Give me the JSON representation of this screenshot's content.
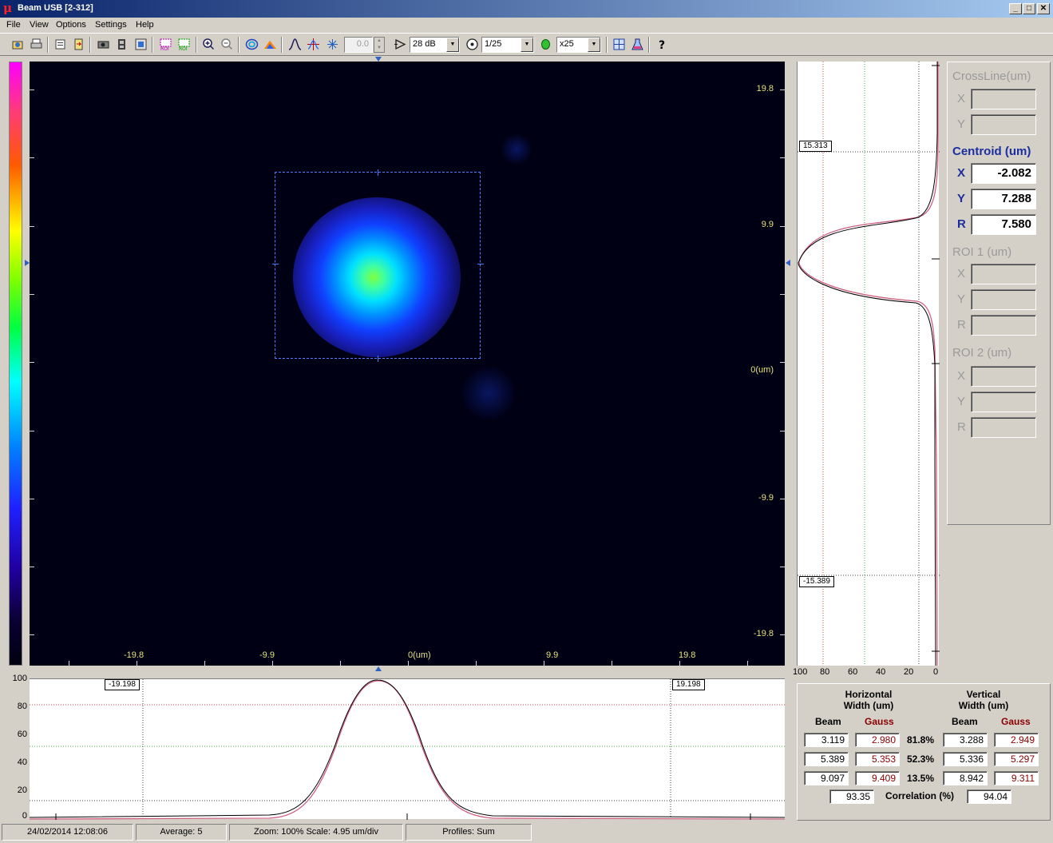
{
  "window": {
    "logo_glyph": "μ",
    "title": "Beam USB  [2-312]",
    "controls": [
      "_",
      "□",
      "✕"
    ]
  },
  "menu": [
    "File",
    "View",
    "Options",
    "Settings",
    "Help"
  ],
  "toolbar": {
    "value_field": "0.0",
    "gain": "28 dB",
    "exposure": "1/25",
    "averaging": "x25",
    "icons": [
      "open-icon",
      "print-icon",
      "properties-icon",
      "export-icon",
      "camera-icon",
      "film-icon",
      "snapshot-icon",
      "roi1-icon",
      "roi2-icon",
      "zoom-in-icon",
      "zoom-out-icon",
      "contour-icon",
      "3d-view-icon",
      "profile-icon",
      "crosshair-icon",
      "centroid-icon",
      "gain-icon",
      "exposure-icon",
      "average-icon",
      "calibrate-icon",
      "palette-icon",
      "help-icon"
    ]
  },
  "image": {
    "y_labels": [
      "19.8",
      "9.9",
      "0(um)",
      "-9.9",
      "-19.8"
    ],
    "x_labels": [
      "-19.8",
      "-9.9",
      "0(um)",
      "9.9",
      "19.8"
    ]
  },
  "vprofile": {
    "cursor_top": "15.313",
    "cursor_bottom": "-15.389",
    "axis_labels": [
      "100",
      "80",
      "60",
      "40",
      "20",
      "0"
    ]
  },
  "hprofile": {
    "cursor_left": "-19.198",
    "cursor_right": "19.198",
    "axis_labels": [
      "100",
      "80",
      "60",
      "40",
      "20",
      "0"
    ]
  },
  "crossline": {
    "title": "CrossLine(um)",
    "x_label": "X",
    "y_label": "Y",
    "x_value": "",
    "y_value": ""
  },
  "centroid": {
    "title": "Centroid (um)",
    "x_label": "X",
    "y_label": "Y",
    "r_label": "R",
    "x_value": "-2.082",
    "y_value": "7.288",
    "r_value": "7.580"
  },
  "roi1": {
    "title": "ROI 1 (um)",
    "x_label": "X",
    "y_label": "Y",
    "r_label": "R",
    "x_value": "",
    "y_value": "",
    "r_value": ""
  },
  "roi2": {
    "title": "ROI 2 (um)",
    "x_label": "X",
    "y_label": "Y",
    "r_label": "R",
    "x_value": "",
    "y_value": "",
    "r_value": ""
  },
  "widths": {
    "horizontal_title": "Horizontal\nWidth  (um)",
    "vertical_title": "Vertical\nWidth  (um)",
    "beam_label": "Beam",
    "gauss_label": "Gauss",
    "rows": [
      {
        "h_beam": "3.119",
        "h_gauss": "2.980",
        "pct": "81.8%",
        "v_beam": "3.288",
        "v_gauss": "2.949"
      },
      {
        "h_beam": "5.389",
        "h_gauss": "5.353",
        "pct": "52.3%",
        "v_beam": "5.336",
        "v_gauss": "5.297"
      },
      {
        "h_beam": "9.097",
        "h_gauss": "9.409",
        "pct": "13.5%",
        "v_beam": "8.942",
        "v_gauss": "9.311"
      }
    ],
    "correlation_label": "Correlation (%)",
    "h_correlation": "93.35",
    "v_correlation": "94.04"
  },
  "status": {
    "datetime": "24/02/2014 12:08:06",
    "average": "Average: 5",
    "zoom": "Zoom: 100%  Scale: 4.95 um/div",
    "profiles": "Profiles: Sum"
  },
  "colors": {
    "title_gradient_start": "#0a246a",
    "title_gradient_end": "#a6caf0",
    "axis_label": "#e6e27a",
    "beam_curve": "#000000",
    "gauss_curve": "#d0607a",
    "active_blue": "#1a2ea0",
    "gauss_text": "#8a0000"
  }
}
